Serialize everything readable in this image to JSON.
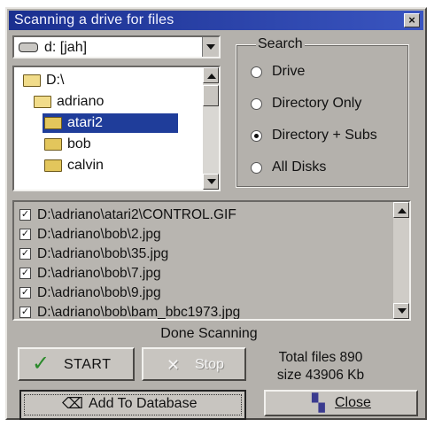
{
  "window": {
    "title": "Scanning a drive for files",
    "close_glyph": "×"
  },
  "drive_select": {
    "value": "d: [jah]",
    "icon": "drive-icon"
  },
  "tree": {
    "items": [
      {
        "label": "D:\\",
        "icon": "open-folder-icon",
        "indent": 0,
        "selected": false
      },
      {
        "label": "adriano",
        "icon": "open-folder-icon",
        "indent": 1,
        "selected": false
      },
      {
        "label": "atari2",
        "icon": "folder-icon",
        "indent": 2,
        "selected": true
      },
      {
        "label": "bob",
        "icon": "folder-icon",
        "indent": 2,
        "selected": false
      },
      {
        "label": "calvin",
        "icon": "folder-icon",
        "indent": 2,
        "selected": false
      }
    ]
  },
  "search": {
    "label": "Search",
    "options": [
      {
        "label": "Drive",
        "checked": false
      },
      {
        "label": "Directory Only",
        "checked": false
      },
      {
        "label": "Directory + Subs",
        "checked": true
      },
      {
        "label": "All Disks",
        "checked": false
      }
    ]
  },
  "results": [
    "D:\\adriano\\atari2\\CONTROL.GIF",
    "D:\\adriano\\bob\\2.jpg",
    "D:\\adriano\\bob\\35.jpg",
    "D:\\adriano\\bob\\7.jpg",
    "D:\\adriano\\bob\\9.jpg",
    "D:\\adriano\\bob\\bam_bbc1973.jpg"
  ],
  "status": "Done Scanning",
  "buttons": {
    "start": "START",
    "stop": "Stop",
    "add": "Add To Database",
    "close": "Close"
  },
  "totals": {
    "files": "Total files 890",
    "size": "size 43906 Kb"
  },
  "colors": {
    "selection": "#1f3d9a",
    "title_bar": "#1a2f8f",
    "start_check": "#2a8a2a"
  }
}
